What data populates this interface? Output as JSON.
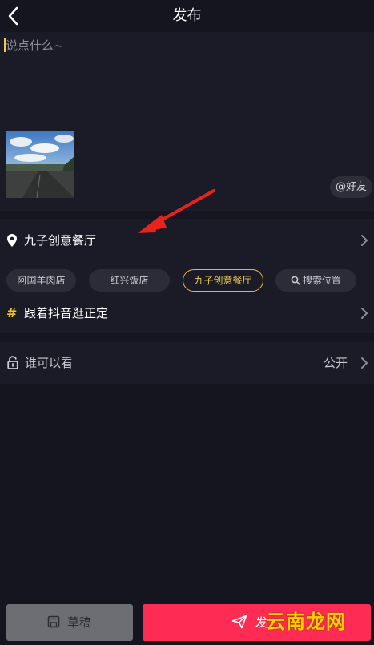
{
  "header": {
    "title": "发布"
  },
  "compose": {
    "placeholder": "说点什么~",
    "mention_label": "好友"
  },
  "location": {
    "selected": "九子创意餐厅",
    "chips": [
      "阿国羊肉店",
      "红兴饭店",
      "九子创意餐厅",
      "搜索位置"
    ],
    "selected_chip_index": 2
  },
  "topic": {
    "label": "跟着抖音逛正定"
  },
  "privacy": {
    "label": "谁可以看",
    "value": "公开"
  },
  "bottom": {
    "draft_label": "草稿",
    "publish_label": "发",
    "watermark": "云南龙网"
  },
  "colors": {
    "accent_yellow": "#f2c94c",
    "publish_red": "#fe2c55",
    "annotation_arrow": "#e8221c"
  },
  "icons": {
    "back": "chevron-left-icon",
    "location": "location-pin-icon",
    "topic": "hashtag-icon",
    "privacy": "unlock-icon",
    "search": "search-icon",
    "draft": "draft-icon",
    "send": "paper-plane-icon",
    "chevron": "chevron-right-icon"
  }
}
